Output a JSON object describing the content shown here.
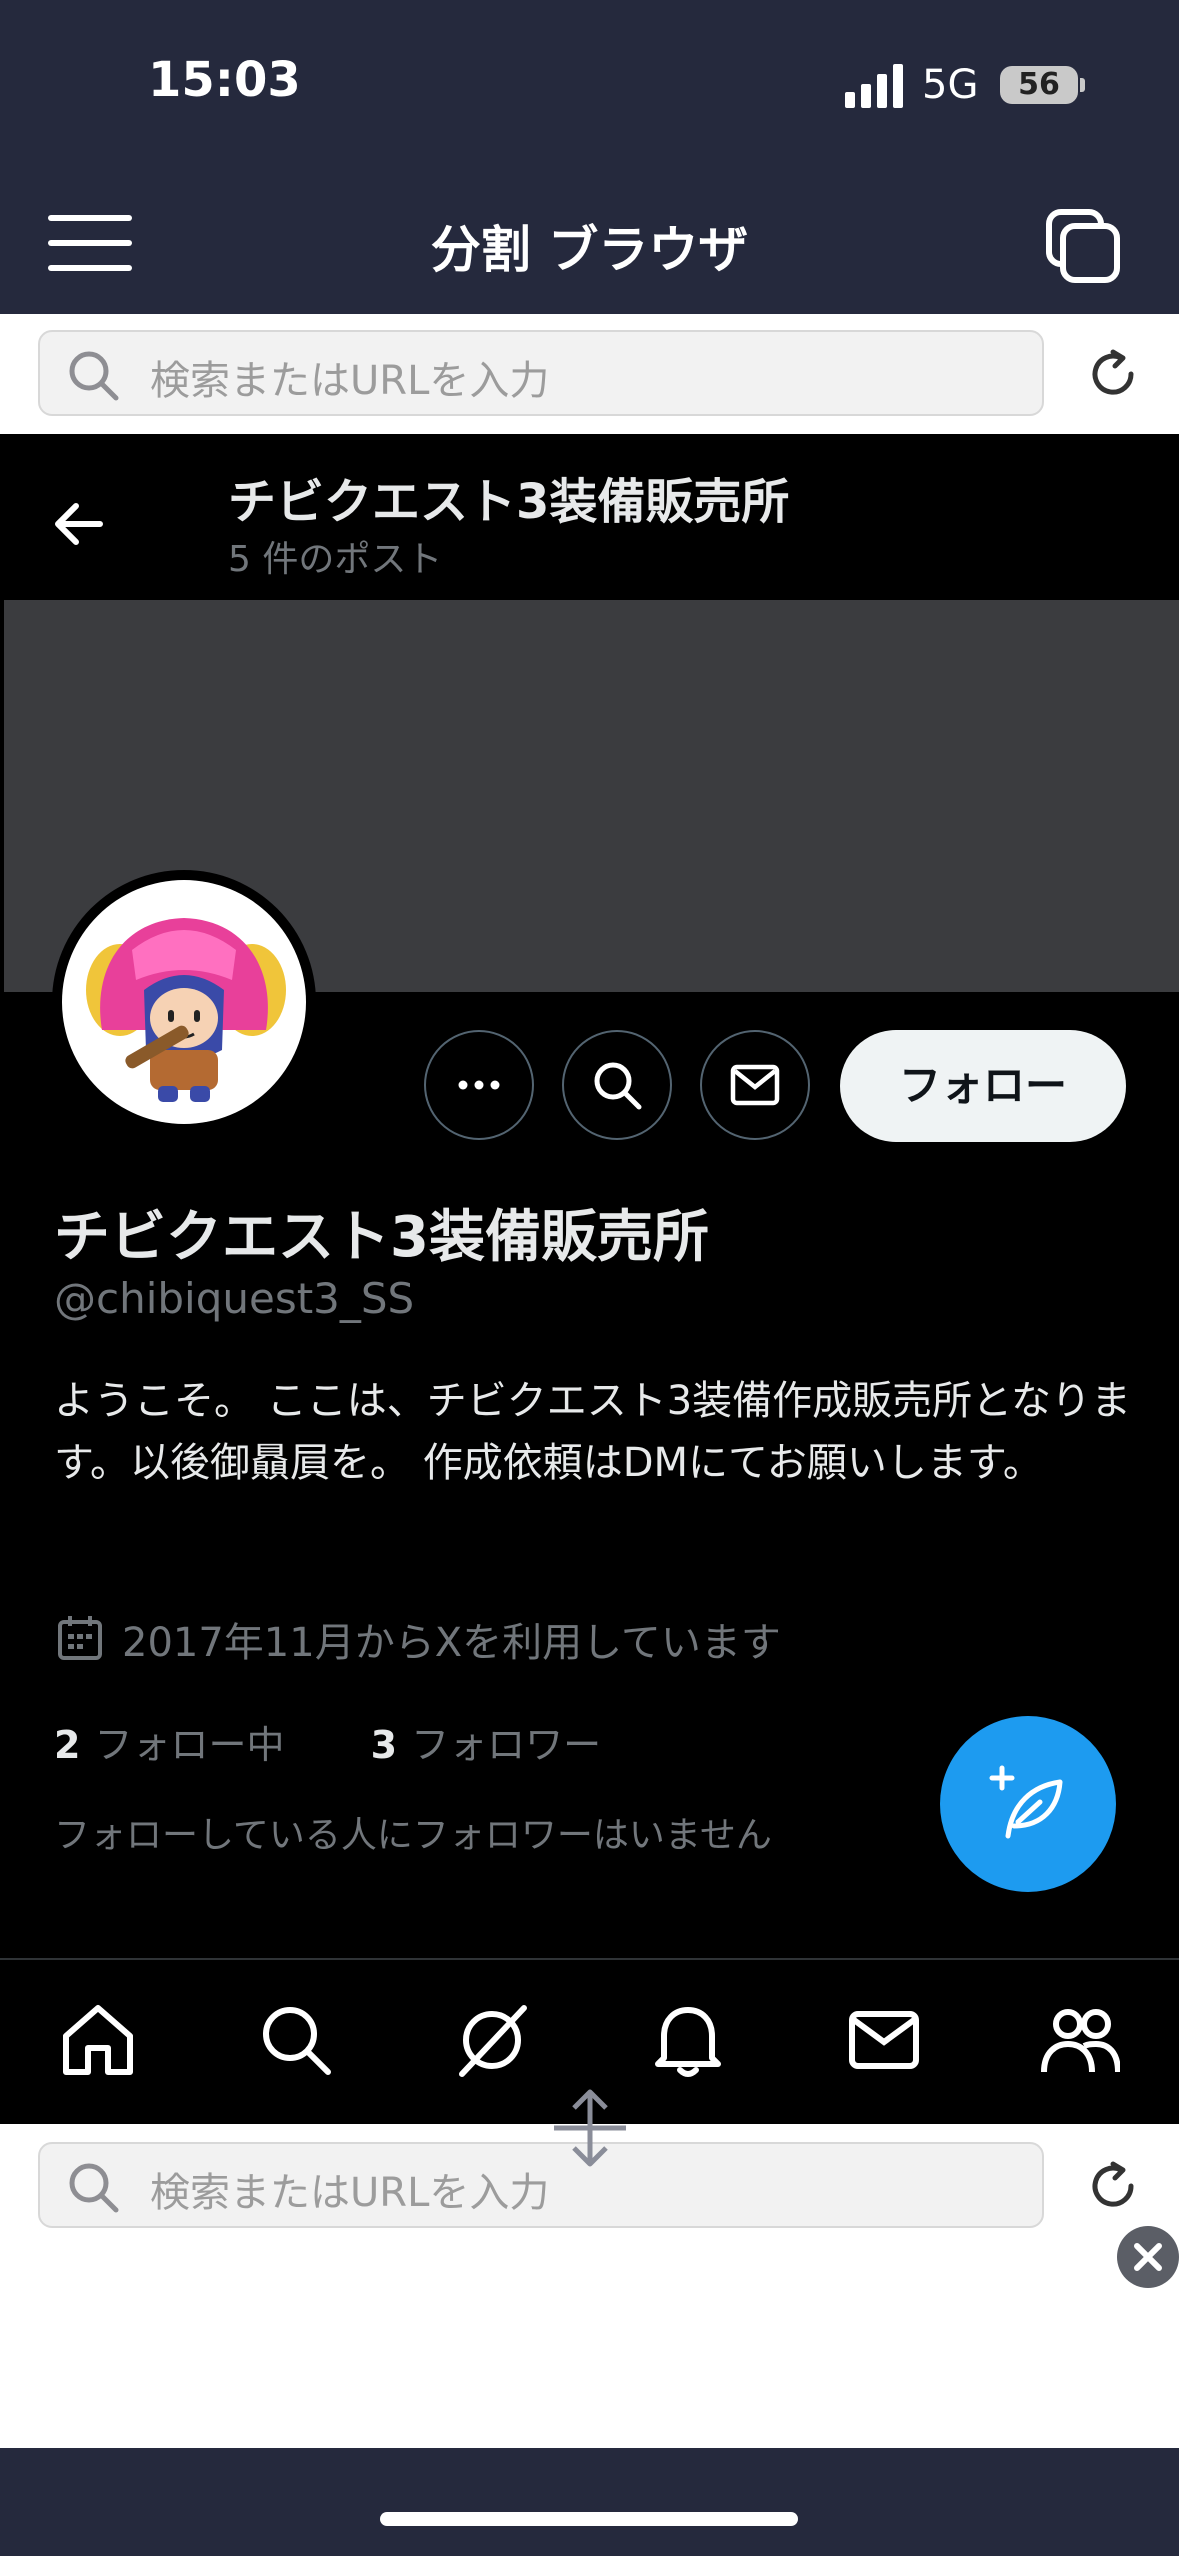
{
  "status_bar": {
    "time": "15:03",
    "network": "5G",
    "battery": "56"
  },
  "app": {
    "title": "分割 ブラウザ"
  },
  "top_pane": {
    "url_placeholder": "検索またはURLを入力"
  },
  "profile": {
    "header_name": "チビクエスト3装備販売所",
    "header_post_count": "5 件のポスト",
    "name": "チビクエスト3装備販売所",
    "handle": "@chibiquest3_SS",
    "bio": "ようこそ。 ここは、チビクエスト3装備作成販売所となります。以後御贔屓を。 作成依頼はDMにてお願いします。",
    "joined": "2017年11月からXを利用しています",
    "following_count": "2",
    "following_label": "フォロー中",
    "followers_count": "3",
    "followers_label": "フォロワー",
    "no_followers_note": "フォローしている人にフォロワーはいません",
    "follow_button": "フォロー"
  },
  "bottom_pane": {
    "url_placeholder": "検索またはURLを入力"
  },
  "colors": {
    "accent": "#1d9bf0",
    "app_bar": "#25293d",
    "page_bg": "#000000"
  }
}
